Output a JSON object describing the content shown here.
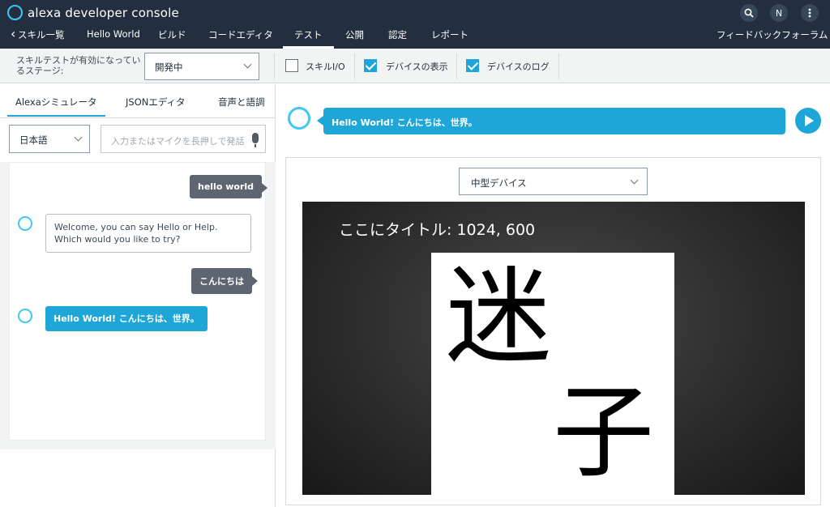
{
  "header": {
    "console_title": "alexa developer console",
    "search_icon": "search-icon",
    "avatar_initial": "N",
    "more_icon": "more-vertical-icon"
  },
  "nav": {
    "back_label": "スキル一覧",
    "items": [
      "Hello World",
      "ビルド",
      "コードエディタ",
      "テスト",
      "公開",
      "認定",
      "レポート"
    ],
    "active": "テスト",
    "feedback_label": "フィードバックフォーラム"
  },
  "stage_bar": {
    "label": "スキルテストが有効になっているステージ:",
    "stage_value": "開発中",
    "options": [
      {
        "label": "スキルI/O",
        "checked": false
      },
      {
        "label": "デバイスの表示",
        "checked": true
      },
      {
        "label": "デバイスのログ",
        "checked": true
      }
    ]
  },
  "left": {
    "tabs": [
      "Alexaシミュレータ",
      "JSONエディタ",
      "音声と語調"
    ],
    "active_tab": "Alexaシミュレータ",
    "language": "日本語",
    "input_placeholder": "入力またはマイクを長押しで発話",
    "conversation": [
      {
        "role": "user",
        "text": "hello world"
      },
      {
        "role": "alexa",
        "text": "Welcome, you can say Hello or Help. Which would you like to try?"
      },
      {
        "role": "user",
        "text": "こんにちは"
      },
      {
        "role": "alexa",
        "text": "Hello World! こんにちは、世界。"
      }
    ]
  },
  "right": {
    "response_text": "Hello World! こんにちは、世界。",
    "device_size": "中型デバイス",
    "screen_title": "ここにタイトル: 1024, 600",
    "image_text": [
      "迷",
      "子"
    ]
  },
  "colors": {
    "header_bg": "#232f3e",
    "accent": "#1fa6d8",
    "alexa_ring": "#3fc8f1",
    "user_bubble": "#5d6670"
  }
}
